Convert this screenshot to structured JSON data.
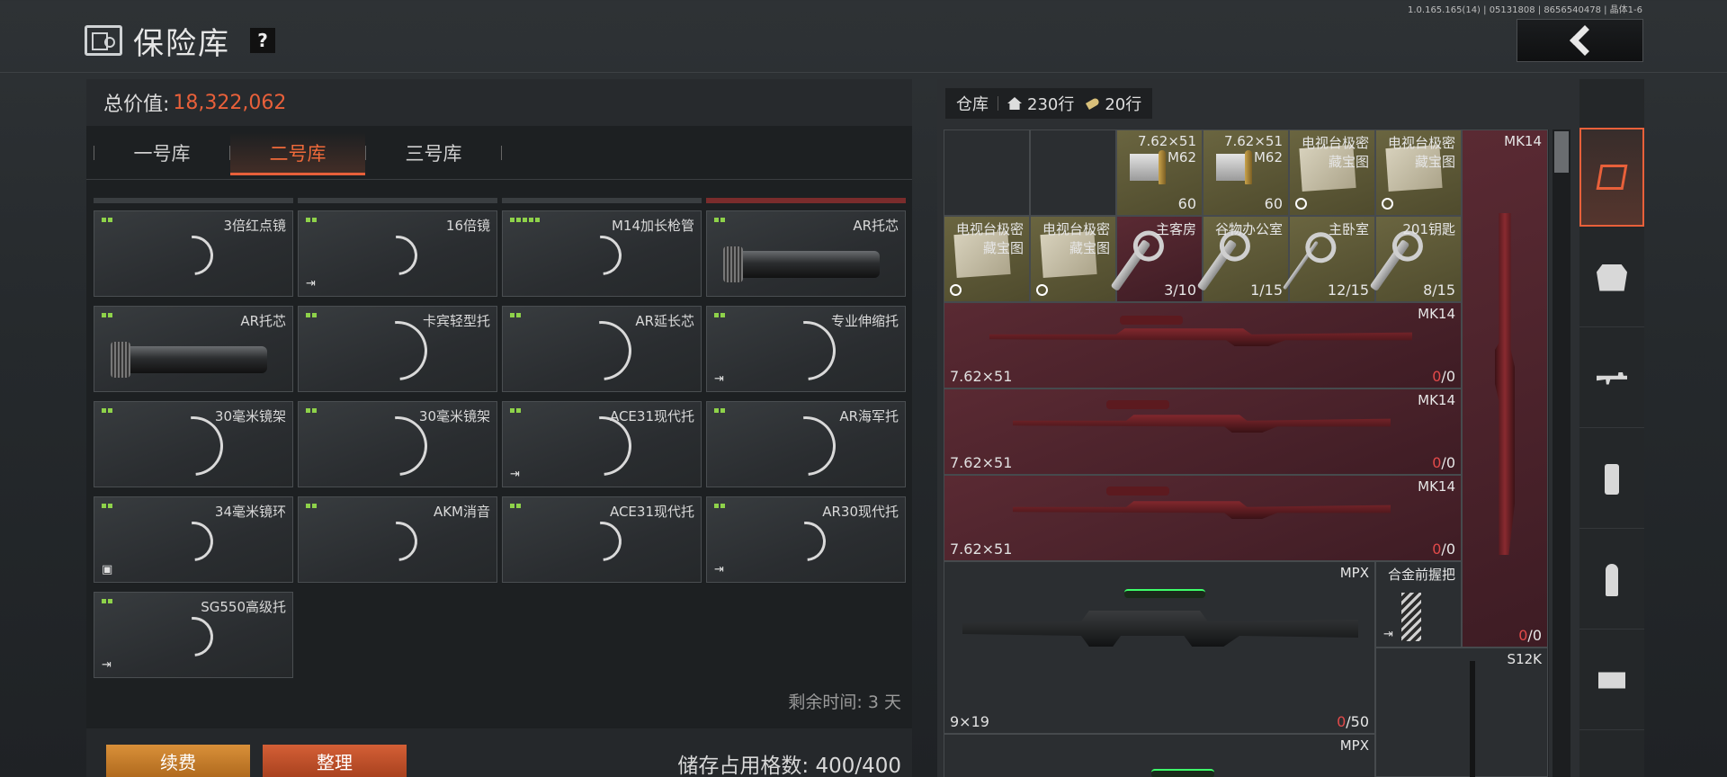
{
  "version_text": "1.0.165.165(14) | 05131808 | 8656540478 | 晶体1-6",
  "header": {
    "title": "保险库",
    "help_label": "?"
  },
  "left": {
    "total_label": "总价值:",
    "total_value": "18,322,062",
    "tabs": [
      {
        "label": "一号库",
        "active": false
      },
      {
        "label": "二号库",
        "active": true
      },
      {
        "label": "三号库",
        "active": false
      }
    ],
    "items": [
      {
        "name": "3倍红点镜",
        "dots": 2,
        "ring": "sm",
        "export": false
      },
      {
        "name": "16倍镜",
        "dots": 2,
        "ring": "sm",
        "export": true
      },
      {
        "name": "M14加长枪管",
        "dots": 5,
        "ring": "sm",
        "export": false
      },
      {
        "name": "AR托芯",
        "dots": 2,
        "tube": true,
        "export": false
      },
      {
        "name": "AR托芯",
        "dots": 2,
        "tube": true,
        "export": false
      },
      {
        "name": "卡宾轻型托",
        "dots": 2,
        "ring": "lg",
        "export": false
      },
      {
        "name": "AR延长芯",
        "dots": 2,
        "ring": "lg",
        "export": false
      },
      {
        "name": "专业伸缩托",
        "dots": 2,
        "ring": "lg",
        "export": true
      },
      {
        "name": "30毫米镜架",
        "dots": 2,
        "ring": "lg",
        "export": false
      },
      {
        "name": "30毫米镜架",
        "dots": 2,
        "ring": "lg",
        "export": false
      },
      {
        "name": "ACE31现代托",
        "dots": 2,
        "ring": "lg",
        "export": true
      },
      {
        "name": "AR海军托",
        "dots": 2,
        "ring": "lg",
        "export": false
      },
      {
        "name": "34毫米镜环",
        "dots": 2,
        "ring": "sm",
        "export": false,
        "box": true
      },
      {
        "name": "AKM消音",
        "dots": 2,
        "ring": "sm",
        "export": false
      },
      {
        "name": "ACE31现代托",
        "dots": 2,
        "ring": "sm",
        "export": false
      },
      {
        "name": "AR30现代托",
        "dots": 2,
        "ring": "sm",
        "export": true
      },
      {
        "name": "SG550高级托",
        "dots": 2,
        "ring": "sm",
        "export": true
      }
    ],
    "remaining_time": "剩余时间: 3 天",
    "renew_label": "续费",
    "sort_label": "整理",
    "storage_text": "储存占用格数: 400/400"
  },
  "right": {
    "warehouse_label": "仓库",
    "rows_label": "230行",
    "ammo_rows_label": "20行",
    "ammo": [
      {
        "line1": "7.62×51",
        "line2": "M62",
        "count": "60"
      },
      {
        "line1": "7.62×51",
        "line2": "M62",
        "count": "60"
      }
    ],
    "maps": [
      {
        "line1": "电视台极密",
        "line2": "藏宝图"
      },
      {
        "line1": "电视台极密",
        "line2": "藏宝图"
      },
      {
        "line1": "电视台极密",
        "line2": "藏宝图"
      },
      {
        "line1": "电视台极密",
        "line2": "藏宝图"
      }
    ],
    "keys": [
      {
        "name": "主客房",
        "count": "3/10"
      },
      {
        "name": "谷物办公室",
        "count": "1/15"
      },
      {
        "name": "主卧室",
        "count": "12/15"
      },
      {
        "name": "201钥匙",
        "count": "8/15"
      }
    ],
    "mk14_rows": [
      {
        "name": "MK14",
        "caliber": "7.62×51",
        "count_red": "0",
        "count_rest": "/0"
      },
      {
        "name": "MK14",
        "caliber": "7.62×51",
        "count_red": "0",
        "count_rest": "/0"
      },
      {
        "name": "MK14",
        "caliber": "7.62×51",
        "count_red": "0",
        "count_rest": "/0"
      }
    ],
    "mk14_vertical": {
      "name": "MK14",
      "count_red": "0",
      "count_rest": "/0"
    },
    "mpx": {
      "name": "MPX",
      "caliber": "9×19",
      "count_red": "0",
      "count_rest": "/50"
    },
    "grip": {
      "name": "合金前握把"
    },
    "s12k": {
      "name": "S12K"
    },
    "mpx2": {
      "name": "MPX"
    }
  },
  "side_categories": [
    "all-items-icon",
    "armor-icon",
    "rifle-icon",
    "magazine-icon",
    "ammo-icon",
    "sight-icon"
  ],
  "colors": {
    "accent": "#e8603a",
    "value": "#e8603a",
    "rarity_dot": "#8ed24a",
    "gold": "#6a6540",
    "red": "#5a2a33"
  }
}
